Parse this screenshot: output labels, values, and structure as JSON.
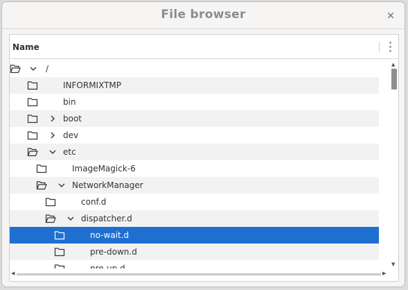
{
  "window": {
    "title": "File browser",
    "close_label": "×"
  },
  "columns": {
    "name_label": "Name"
  },
  "tree": [
    {
      "label": "/",
      "expander": "expanded",
      "icon": "folder-open-icon",
      "depth": 0
    },
    {
      "label": "INFORMIXTMP",
      "expander": "none",
      "icon": "folder-icon",
      "depth": 1
    },
    {
      "label": "bin",
      "expander": "none",
      "icon": "folder-icon",
      "depth": 1
    },
    {
      "label": "boot",
      "expander": "collapsed",
      "icon": "folder-icon",
      "depth": 1
    },
    {
      "label": "dev",
      "expander": "collapsed",
      "icon": "folder-icon",
      "depth": 1
    },
    {
      "label": "etc",
      "expander": "expanded",
      "icon": "folder-open-icon",
      "depth": 1
    },
    {
      "label": "ImageMagick-6",
      "expander": "none",
      "icon": "folder-icon",
      "depth": 2
    },
    {
      "label": "NetworkManager",
      "expander": "expanded",
      "icon": "folder-open-icon",
      "depth": 2
    },
    {
      "label": "conf.d",
      "expander": "none",
      "icon": "folder-icon",
      "depth": 3
    },
    {
      "label": "dispatcher.d",
      "expander": "expanded",
      "icon": "folder-open-icon",
      "depth": 3
    },
    {
      "label": "no-wait.d",
      "expander": "none",
      "icon": "folder-icon",
      "depth": 4,
      "selected": true
    },
    {
      "label": "pre-down.d",
      "expander": "none",
      "icon": "folder-icon",
      "depth": 4
    },
    {
      "label": "pre-up.d",
      "expander": "none",
      "icon": "folder-icon",
      "depth": 4
    }
  ],
  "colors": {
    "selection": "#1f6fd0",
    "stripe": "#f2f2f2"
  }
}
